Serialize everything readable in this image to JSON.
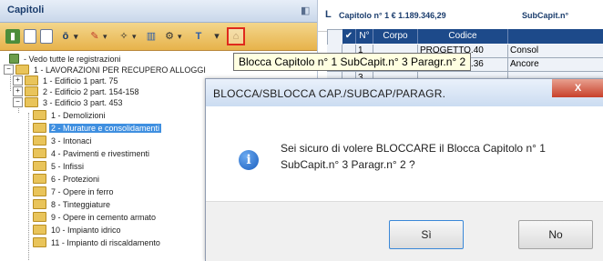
{
  "left_panel": {
    "title": "Capitoli",
    "tree": [
      {
        "label": "- Vedo tutte le registrazioni",
        "level": 0,
        "expand": "",
        "sel": false
      },
      {
        "label": "1 - LAVORAZIONI PER RECUPERO ALLOGGI",
        "level": 0,
        "expand": "−",
        "sel": false
      },
      {
        "label": "1 - Edificio 1 part. 75",
        "level": 1,
        "expand": "+",
        "sel": false
      },
      {
        "label": "2 - Edificio 2 part. 154-158",
        "level": 1,
        "expand": "+",
        "sel": false
      },
      {
        "label": "3 - Edificio 3 part. 453",
        "level": 1,
        "expand": "−",
        "sel": false
      },
      {
        "label": "1 - Demolizioni",
        "level": 2,
        "expand": "",
        "sel": false
      },
      {
        "label": "2 - Murature e consolidamenti",
        "level": 2,
        "expand": "",
        "sel": true
      },
      {
        "label": "3 - Intonaci",
        "level": 2,
        "expand": "",
        "sel": false
      },
      {
        "label": "4 - Pavimenti e rivestimenti",
        "level": 2,
        "expand": "",
        "sel": false
      },
      {
        "label": "5 - Infissi",
        "level": 2,
        "expand": "",
        "sel": false
      },
      {
        "label": "6 - Protezioni",
        "level": 2,
        "expand": "",
        "sel": false
      },
      {
        "label": "7 - Opere in ferro",
        "level": 2,
        "expand": "",
        "sel": false
      },
      {
        "label": "8 - Tinteggiature",
        "level": 2,
        "expand": "",
        "sel": false
      },
      {
        "label": "9 - Opere in cemento armato",
        "level": 2,
        "expand": "",
        "sel": false
      },
      {
        "label": "10 - Impianto idrico",
        "level": 2,
        "expand": "",
        "sel": false
      },
      {
        "label": "11 - Impianto di riscaldamento",
        "level": 2,
        "expand": "",
        "sel": false
      }
    ]
  },
  "right_panel": {
    "header_letter": "L",
    "caption": "Capitolo n° 1 € 1.189.346,29",
    "subcaption": "SubCapit.n°",
    "columns": [
      "N°",
      "Corpo",
      "Codice"
    ],
    "rows": [
      {
        "n": "1",
        "corpo": "",
        "codice": "PROGETTO.40",
        "extra": "Consol"
      },
      {
        "n": "2",
        "corpo": "",
        "codice": "PROGETTO.36",
        "extra": "Ancore"
      },
      {
        "n": "3",
        "corpo": "",
        "codice": "",
        "extra": ""
      }
    ]
  },
  "tooltip": "Blocca Capitolo n° 1 SubCapit.n° 3 Paragr.n° 2",
  "dialog": {
    "title": "BLOCCA/SBLOCCA CAP./SUBCAP/PARAGR.",
    "close": "X",
    "message_line1": "Sei sicuro di volere BLOCCARE il  Blocca Capitolo n° 1",
    "message_line2": "SubCapit.n° 3 Paragr.n° 2 ?",
    "yes": "Sì",
    "no": "No",
    "icon": "info-icon"
  },
  "toolbar_icons": [
    "open-icon",
    "new-doc-icon",
    "copy-icon",
    "filter-icon",
    "pencil-icon",
    "wand-icon",
    "chart-icon",
    "settings-icon",
    "text-icon",
    "lock-icon"
  ],
  "colors": {
    "accent": "#1d4a8a",
    "highlight": "#e0291c",
    "selection": "#3f8fe0",
    "toolbar": "#e7b34b"
  }
}
